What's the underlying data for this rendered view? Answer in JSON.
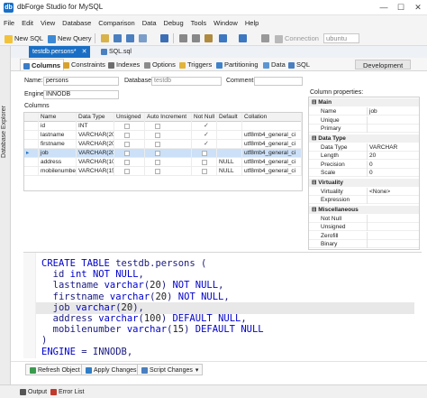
{
  "window": {
    "title": "dbForge Studio for MySQL",
    "minimize": "—",
    "maximize": "☐",
    "close": "✕",
    "app_icon": "db"
  },
  "menu": [
    "File",
    "Edit",
    "View",
    "Database",
    "Comparison",
    "Data",
    "Debug",
    "Tools",
    "Window",
    "Help"
  ],
  "toolbar": {
    "new_sql": "New SQL",
    "new_query": "New Query",
    "connection_label": "Connection",
    "connection_value": "ubuntu"
  },
  "sidebar": {
    "label": "Database Explorer"
  },
  "doc_tabs": [
    {
      "label": "testdb.persons*",
      "close": "✕"
    },
    {
      "label": "SQL.sql"
    }
  ],
  "inner_tabs": [
    "Columns",
    "Constraints",
    "Indexes",
    "Options",
    "Triggers",
    "Partitioning",
    "Data",
    "SQL"
  ],
  "dev_button": "Development",
  "props": {
    "name_label": "Name:",
    "name_value": "persons",
    "database_label": "Database:",
    "database_value": "testdb",
    "comment_label": "Comment:",
    "comment_value": "",
    "engine_label": "Engine:",
    "engine_value": "INNODB",
    "columns_label": "Columns"
  },
  "grid": {
    "headers": [
      "Name",
      "Data Type",
      "Unsigned",
      "Auto Increment",
      "Not Null",
      "Default",
      "Collation"
    ],
    "rows": [
      {
        "name": "id",
        "type": "INT",
        "unsigned": "",
        "ai": "",
        "notnull": "✓",
        "default": "",
        "collation": ""
      },
      {
        "name": "lastname",
        "type": "VARCHAR(20)",
        "unsigned": "",
        "ai": "",
        "notnull": "✓",
        "default": "",
        "collation": "utf8mb4_general_ci"
      },
      {
        "name": "firstname",
        "type": "VARCHAR(20)",
        "unsigned": "",
        "ai": "",
        "notnull": "✓",
        "default": "",
        "collation": "utf8mb4_general_ci"
      },
      {
        "name": "job",
        "type": "VARCHAR(20)",
        "unsigned": "",
        "ai": "",
        "notnull": "",
        "default": "",
        "collation": "utf8mb4_general_ci"
      },
      {
        "name": "address",
        "type": "VARCHAR(100)",
        "unsigned": "",
        "ai": "",
        "notnull": "",
        "default": "NULL",
        "collation": "utf8mb4_general_ci"
      },
      {
        "name": "mobilenumber",
        "type": "VARCHAR(15)",
        "unsigned": "",
        "ai": "",
        "notnull": "",
        "default": "NULL",
        "collation": "utf8mb4_general_ci"
      }
    ]
  },
  "colprops": {
    "title": "Column properties:",
    "sections": [
      {
        "head": "Main",
        "rows": [
          [
            "Name",
            "job"
          ],
          [
            "Unique",
            ""
          ],
          [
            "Primary",
            ""
          ]
        ]
      },
      {
        "head": "Data Type",
        "rows": [
          [
            "Data Type",
            "VARCHAR"
          ],
          [
            "Length",
            "20"
          ],
          [
            "Precision",
            "0"
          ],
          [
            "Scale",
            "0"
          ]
        ]
      },
      {
        "head": "Virtuality",
        "rows": [
          [
            "Virtuality",
            "<None>"
          ],
          [
            "Expression",
            ""
          ]
        ]
      },
      {
        "head": "Miscellaneous",
        "rows": [
          [
            "Not Null",
            ""
          ],
          [
            "Unsigned",
            ""
          ],
          [
            "Zerofill",
            ""
          ],
          [
            "Binary",
            ""
          ]
        ]
      }
    ]
  },
  "editor": {
    "lines": [
      "CREATE TABLE testdb.persons (",
      "  id int NOT NULL,",
      "  lastname varchar(20) NOT NULL,",
      "  firstname varchar(20) NOT NULL,",
      "  job varchar(20),",
      "  address varchar(100) DEFAULT NULL,",
      "  mobilenumber varchar(15) DEFAULT NULL",
      ")",
      "ENGINE = INNODB,"
    ]
  },
  "actions": {
    "refresh": "Refresh Object",
    "apply": "Apply Changes",
    "script": "Script Changes"
  },
  "statusbar": {
    "output": "Output",
    "errors": "Error List"
  },
  "colors": {
    "accent": "#1a6fc4",
    "selection": "#cce0f7",
    "keyword": "#0000cc"
  }
}
